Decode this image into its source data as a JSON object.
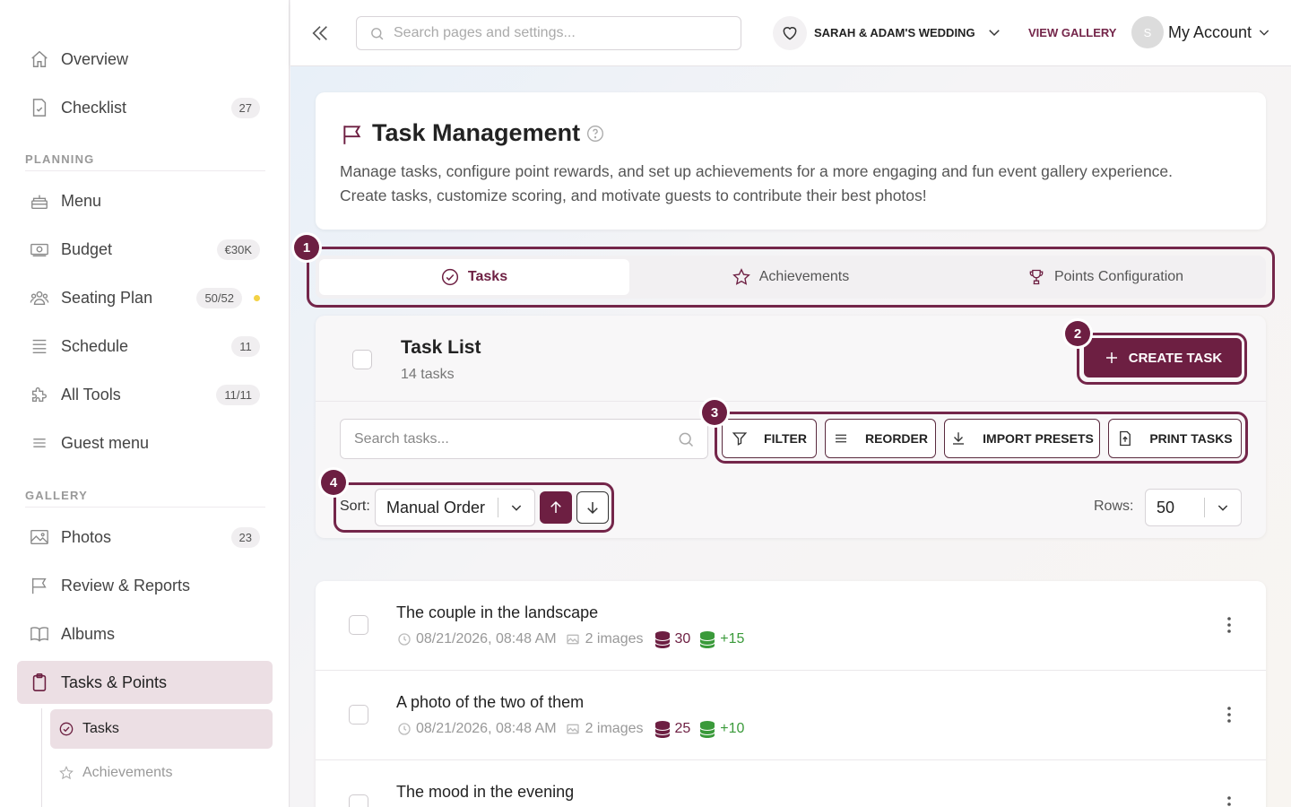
{
  "sidebar": {
    "items": [
      {
        "label": "Overview",
        "icon": "home-icon"
      },
      {
        "label": "Checklist",
        "badge": "27",
        "icon": "checklist-icon"
      }
    ],
    "planning_header": "PLANNING",
    "planning": [
      {
        "label": "Menu",
        "icon": "cake-icon"
      },
      {
        "label": "Budget",
        "badge": "€30K",
        "icon": "money-icon"
      },
      {
        "label": "Seating Plan",
        "badge": "50/52",
        "icon": "people-icon"
      },
      {
        "label": "Schedule",
        "badge": "11",
        "icon": "schedule-icon"
      },
      {
        "label": "All Tools",
        "badge": "11/11",
        "icon": "puzzle-icon"
      },
      {
        "label": "Guest menu",
        "icon": "menu-icon"
      }
    ],
    "gallery_header": "GALLERY",
    "gallery": [
      {
        "label": "Photos",
        "badge": "23",
        "icon": "image-icon"
      },
      {
        "label": "Review & Reports",
        "icon": "flag-icon"
      },
      {
        "label": "Albums",
        "icon": "book-icon"
      },
      {
        "label": "Tasks & Points",
        "icon": "clipboard-icon"
      }
    ],
    "sub": [
      {
        "label": "Tasks",
        "icon": "check-circle-icon"
      },
      {
        "label": "Achievements",
        "icon": "star-icon"
      }
    ]
  },
  "topbar": {
    "search_placeholder": "Search pages and settings...",
    "event_name": "SARAH & ADAM'S WEDDING",
    "view_gallery": "VIEW GALLERY",
    "avatar_initial": "S",
    "account_label": "My Account"
  },
  "header": {
    "title": "Task Management",
    "description_line1": "Manage tasks, configure point rewards, and set up achievements for a more engaging and fun event gallery experience.",
    "description_line2": "Create tasks, customize scoring, and motivate guests to contribute their best photos!"
  },
  "tabs": [
    {
      "label": "Tasks",
      "active": true
    },
    {
      "label": "Achievements",
      "active": false
    },
    {
      "label": "Points Configuration",
      "active": false
    }
  ],
  "task_list": {
    "title": "Task List",
    "count": "14 tasks",
    "create_label": "CREATE TASK",
    "search_placeholder": "Search tasks...",
    "filter_label": "FILTER",
    "reorder_label": "REORDER",
    "import_label": "IMPORT PRESETS",
    "print_label": "PRINT TASKS",
    "sort_label": "Sort:",
    "sort_value": "Manual Order",
    "rows_label": "Rows:",
    "rows_value": "50"
  },
  "markers": [
    "1",
    "2",
    "3",
    "4"
  ],
  "tasks": [
    {
      "title": "The couple in the landscape",
      "date": "08/21/2026, 08:48 AM",
      "images": "2 images",
      "points": "30",
      "bonus": "+15"
    },
    {
      "title": "A photo of the two of them",
      "date": "08/21/2026, 08:48 AM",
      "images": "2 images",
      "points": "25",
      "bonus": "+10"
    },
    {
      "title": "The mood in the evening"
    }
  ],
  "colors": {
    "accent": "#6d1f42",
    "bonus": "#3a9a3a",
    "active_bg": "#ecdfe4",
    "badge_dot": "#f3d245"
  }
}
